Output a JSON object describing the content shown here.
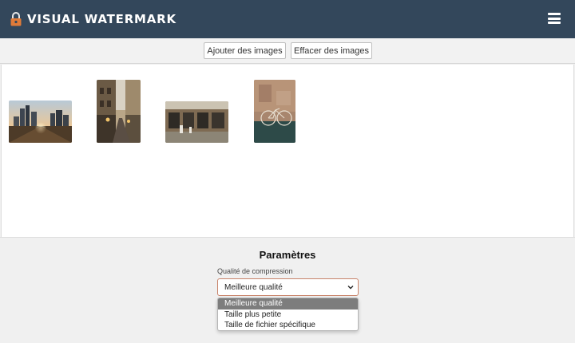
{
  "header": {
    "title": "VISUAL WATERMARK",
    "menu_icon": "hamburger-menu-icon",
    "logo_icon": "padlock-icon",
    "background": "#33475b"
  },
  "toolbar": {
    "add_images_label": "Ajouter des images",
    "clear_images_label": "Effacer des images"
  },
  "images": [
    {
      "name": "city-sunset"
    },
    {
      "name": "street-alley"
    },
    {
      "name": "storefront"
    },
    {
      "name": "bicycle-wall"
    }
  ],
  "settings": {
    "title": "Paramètres",
    "compression_label": "Qualité de compression",
    "compression_value": "Meilleure qualité",
    "options": [
      "Meilleure qualité",
      "Taille plus petite",
      "Taille de fichier spécifique"
    ],
    "selected_index": 0
  }
}
